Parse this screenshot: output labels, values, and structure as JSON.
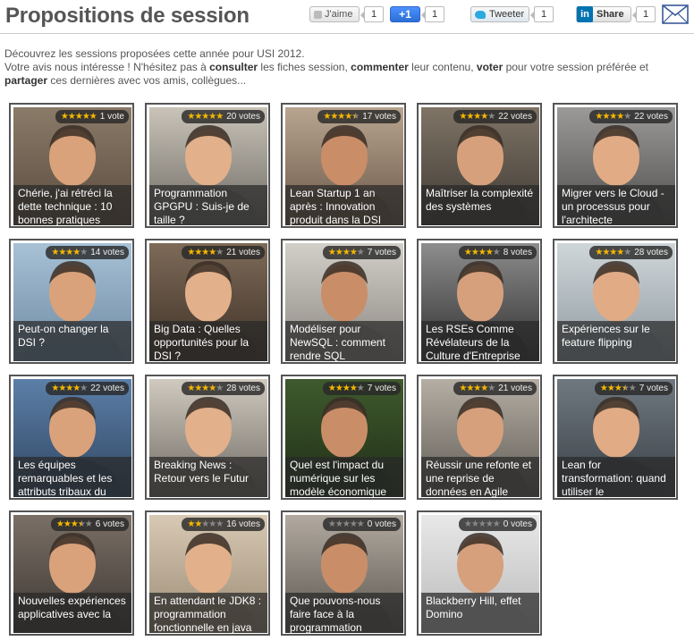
{
  "header": {
    "title": "Propositions de session",
    "like_label": "J'aime",
    "like_count": "1",
    "gplus_label": "+1",
    "gplus_count": "1",
    "tweet_label": "Tweeter",
    "tweet_count": "1",
    "share_label": "Share",
    "share_count": "1",
    "linkedin_logo": "in",
    "mail_icon": "mail-icon"
  },
  "intro": {
    "line1": "Découvrez les sessions proposées cette année pour USI 2012.",
    "p_a": "Votre avis nous intéresse ! N'hésitez pas à ",
    "b_consulter": "consulter",
    "p_b": " les fiches session, ",
    "b_commenter": "commenter",
    "p_c": " leur contenu, ",
    "b_voter": "voter",
    "p_d": " pour votre session préférée et ",
    "b_partager": "partager",
    "p_e": " ces dernières avec vos amis, collègues..."
  },
  "sessions": [
    {
      "title": "Chérie, j'ai rétréci la dette technique : 10 bonnes pratiques",
      "votes": "1 vote",
      "stars": 5
    },
    {
      "title": "Programmation GPGPU : Suis-je de taille ?",
      "votes": "20 votes",
      "stars": 5
    },
    {
      "title": "Lean Startup 1 an après : Innovation produit dans la DSI",
      "votes": "17 votes",
      "stars": 4.5
    },
    {
      "title": "Maîtriser la complexité des systèmes",
      "votes": "22 votes",
      "stars": 4
    },
    {
      "title": "Migrer vers le Cloud - un processus pour l'architecte",
      "votes": "22 votes",
      "stars": 4
    },
    {
      "title": "Peut-on changer la DSI ?",
      "votes": "14 votes",
      "stars": 4
    },
    {
      "title": "Big Data : Quelles opportunités pour la DSI ?",
      "votes": "21 votes",
      "stars": 4
    },
    {
      "title": "Modéliser pour NewSQL : comment rendre SQL",
      "votes": "7 votes",
      "stars": 4
    },
    {
      "title": "Les RSEs Comme Révélateurs de la Culture d'Entreprise",
      "votes": "8 votes",
      "stars": 4
    },
    {
      "title": "Expériences sur le feature flipping",
      "votes": "28 votes",
      "stars": 4
    },
    {
      "title": "Les équipes remarquables et les attributs tribaux du",
      "votes": "22 votes",
      "stars": 4
    },
    {
      "title": "Breaking News : Retour vers le Futur",
      "votes": "28 votes",
      "stars": 4
    },
    {
      "title": "Quel est l'impact du numérique sur les modèle économique",
      "votes": "7 votes",
      "stars": 4
    },
    {
      "title": "Réussir une refonte et une reprise de données en Agile",
      "votes": "21 votes",
      "stars": 4
    },
    {
      "title": "Lean for transformation: quand utiliser le",
      "votes": "7 votes",
      "stars": 3.5
    },
    {
      "title": "Nouvelles expériences applicatives avec la",
      "votes": "6 votes",
      "stars": 3.5
    },
    {
      "title": "En attendant le JDK8 : programmation fonctionnelle en java",
      "votes": "16 votes",
      "stars": 2
    },
    {
      "title": "Que pouvons-nous faire face à la programmation",
      "votes": "0 votes",
      "stars": 0
    },
    {
      "title": "Blackberry Hill, effet Domino",
      "votes": "0 votes",
      "stars": 0
    }
  ],
  "colors": {
    "star_on": "#f5b800",
    "star_off": "#888888",
    "card_border": "#555555",
    "caption_bg": "rgba(40,40,40,0.72)"
  }
}
